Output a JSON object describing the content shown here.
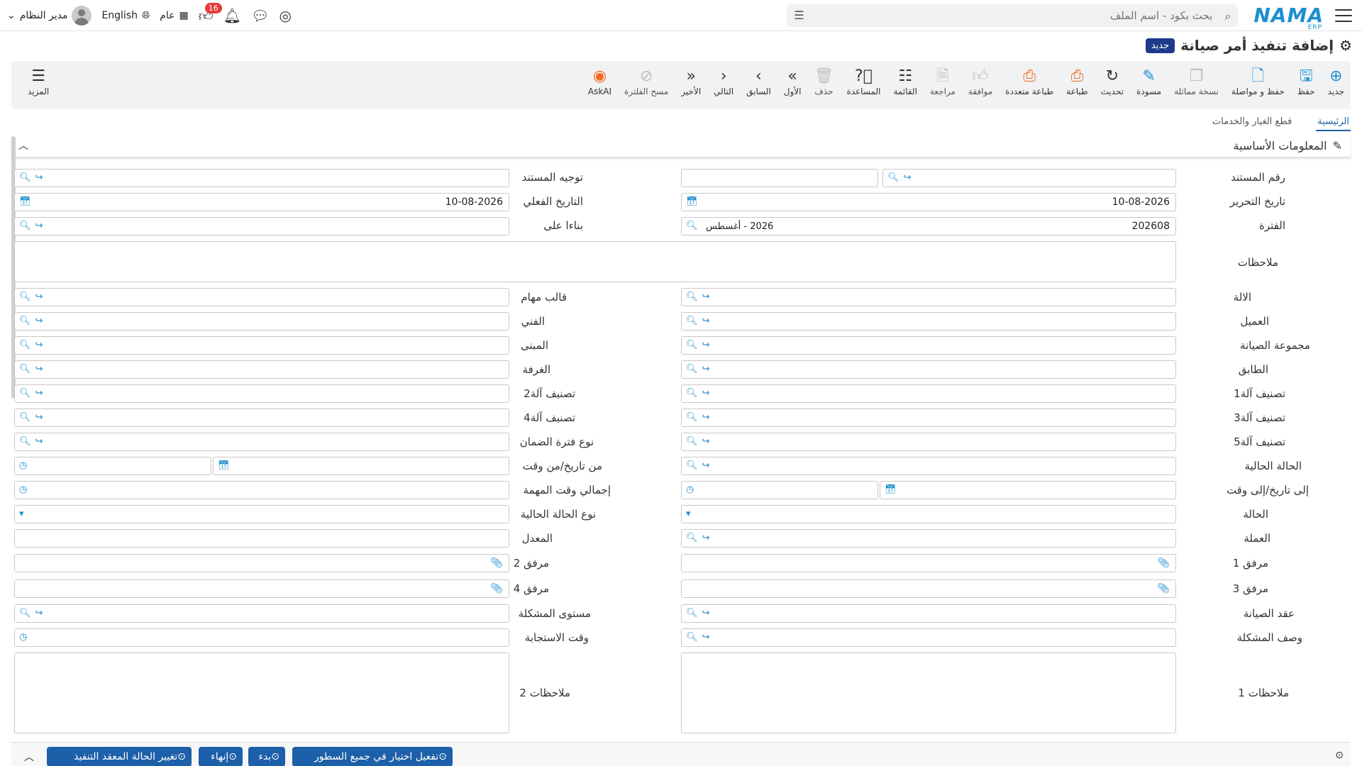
{
  "topbar": {
    "search_placeholder": "بحث بكود - اسم الملف",
    "logo": "NAMA",
    "logo_sub": "ERP",
    "user_name": "مدير النظام",
    "language": "English",
    "general_label": "عام",
    "notifications_count": "16"
  },
  "page": {
    "title": "إضافة تنفيذ أمر صيانة",
    "status_badge": "جديد"
  },
  "toolbar": {
    "new": "جديد",
    "save": "حفظ",
    "save_continue": "حفظ و مواصلة",
    "copy": "نسخة مماثلة",
    "draft": "مسودة",
    "refresh": "تحديث",
    "print": "طباعة",
    "multi_print": "طباعة متعددة",
    "approve": "موافقة",
    "review": "مراجعة",
    "list": "القائمة",
    "help": "المساعدة",
    "delete": "حذف",
    "first": "الأول",
    "previous": "السابق",
    "next": "التالي",
    "last": "الأخير",
    "clear_filter": "مسح الفلترة",
    "askai": "AskAI",
    "more": "المزيد"
  },
  "tabs": [
    "الرئيسية",
    "قطع الغيار والخدمات"
  ],
  "section_title": "المعلومات الأساسية",
  "form": {
    "doc_number": "رقم المستند",
    "doc_direction": "توجيه المستند",
    "edit_date": "تاريخ التحرير",
    "edit_date_value": "10-08-2026",
    "actual_date": "التاريخ الفعلي",
    "actual_date_value": "10-08-2026",
    "period": "الفترة",
    "period_value": "202608",
    "period_name": "2026 - أغسطس",
    "based_on": "بناءا على",
    "notes": "ملاحظات",
    "machine": "الالة",
    "task_template": "قالب مهام",
    "customer": "العميل",
    "technician": "الفني",
    "maint_group": "مجموعة الصيانة",
    "building": "المبنى",
    "floor": "الطابق",
    "room": "الغرفة",
    "class1": "تصنيف آلة1",
    "class2": "تصنيف آلة2",
    "class3": "تصنيف آلة3",
    "class4": "تصنيف آلة4",
    "class5": "تصنيف آلة5",
    "warranty_type": "نوع فترة الضمان",
    "current_state": "الحالة الحالية",
    "from_datetime": "من تاريخ/من وقت",
    "to_datetime": "إلى تاريخ/إلى وقت",
    "total_task_time": "إجمالي وقت المهمة",
    "status": "الحالة",
    "current_state_type": "نوع الحالة الحالية",
    "currency": "العملة",
    "rate": "المعدل",
    "attach1": "مرفق 1",
    "attach2": "مرفق 2",
    "attach3": "مرفق 3",
    "attach4": "مرفق 4",
    "maint_contract": "عقد الصيانة",
    "problem_level": "مستوى المشكلة",
    "problem_desc": "وصف المشكلة",
    "response_time": "وقت الاستجابة",
    "notes1": "ملاحظات 1",
    "notes2": "ملاحظات 2"
  },
  "bottom": {
    "btn_activate_all": "تفعيل اختيار في جميع السطور",
    "btn_start": "بدء",
    "btn_end": "إنهاء",
    "btn_change_state": "تغيير الحالة المعقد التنفيذ"
  },
  "colors": {
    "accent": "#1d8fd0",
    "primary_dark": "#1e3a8a",
    "orange": "#f26a21"
  }
}
